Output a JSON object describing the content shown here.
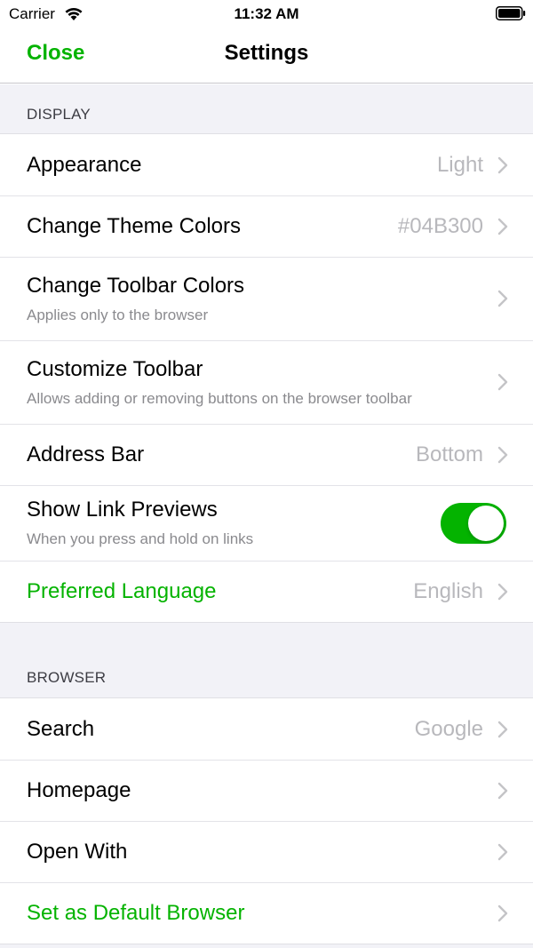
{
  "status_bar": {
    "carrier": "Carrier",
    "time": "11:32 AM",
    "wifi_icon": "wifi-icon",
    "battery_icon": "battery-icon"
  },
  "nav": {
    "close_label": "Close",
    "title": "Settings"
  },
  "colors": {
    "accent": "#04B300",
    "background": "#f2f2f7",
    "secondary_text": "#8a8a8e"
  },
  "sections": {
    "display": {
      "header": "DISPLAY",
      "rows": {
        "appearance": {
          "title": "Appearance",
          "value": "Light"
        },
        "theme_colors": {
          "title": "Change Theme Colors",
          "value": "#04B300"
        },
        "toolbar_colors": {
          "title": "Change Toolbar Colors",
          "subtitle": "Applies only to the browser"
        },
        "customize_toolbar": {
          "title": "Customize Toolbar",
          "subtitle": "Allows adding or removing buttons on the browser toolbar"
        },
        "address_bar": {
          "title": "Address Bar",
          "value": "Bottom"
        },
        "link_previews": {
          "title": "Show Link Previews",
          "subtitle": "When you press and hold on links",
          "enabled": true
        },
        "language": {
          "title": "Preferred Language",
          "value": "English"
        }
      }
    },
    "browser": {
      "header": "BROWSER",
      "rows": {
        "search": {
          "title": "Search",
          "value": "Google"
        },
        "homepage": {
          "title": "Homepage"
        },
        "open_with": {
          "title": "Open With"
        },
        "default_browser": {
          "title": "Set as Default Browser"
        }
      }
    }
  }
}
